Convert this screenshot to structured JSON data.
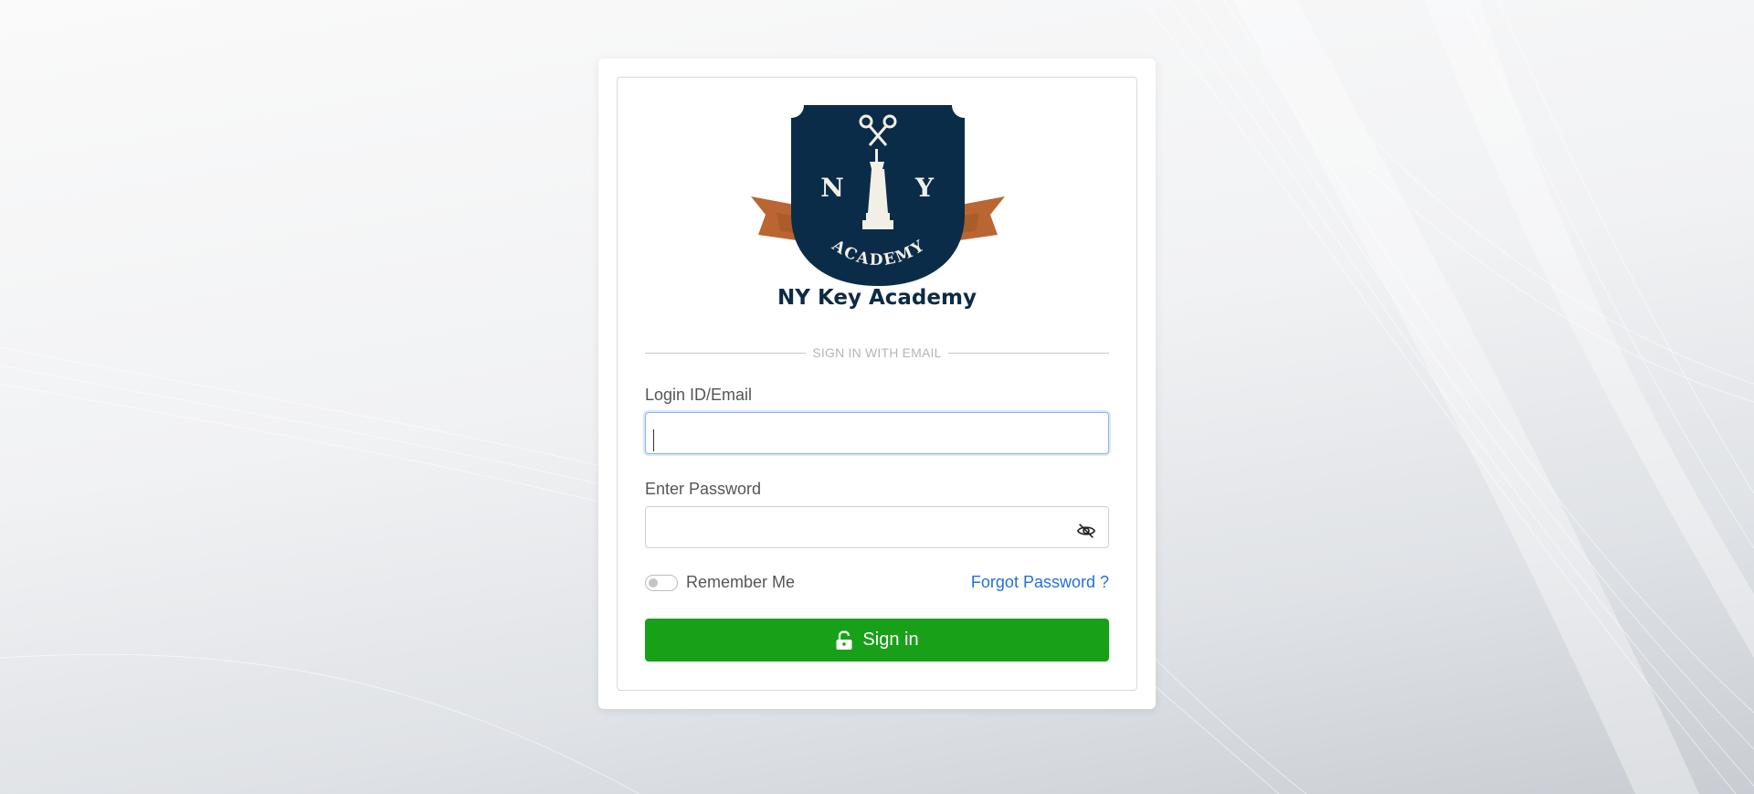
{
  "brand": {
    "name": "NY Key Academy",
    "logo_letters": [
      "N",
      "Y"
    ],
    "logo_banner_text": "ACADEMY",
    "colors": {
      "navy": "#0b2c48",
      "ribbon": "#bb6632",
      "accent": "#18a118",
      "link": "#2370d8"
    }
  },
  "form": {
    "divider_text": "SIGN IN WITH EMAIL",
    "login_label": "Login ID/Email",
    "login_value": "",
    "password_label": "Enter Password",
    "password_value": "",
    "password_toggle_icon": "eye-slash-icon",
    "remember_label": "Remember Me",
    "remember_checked": false,
    "forgot_label": "Forgot Password ?",
    "signin_label": "Sign in",
    "signin_icon": "unlock-icon"
  }
}
